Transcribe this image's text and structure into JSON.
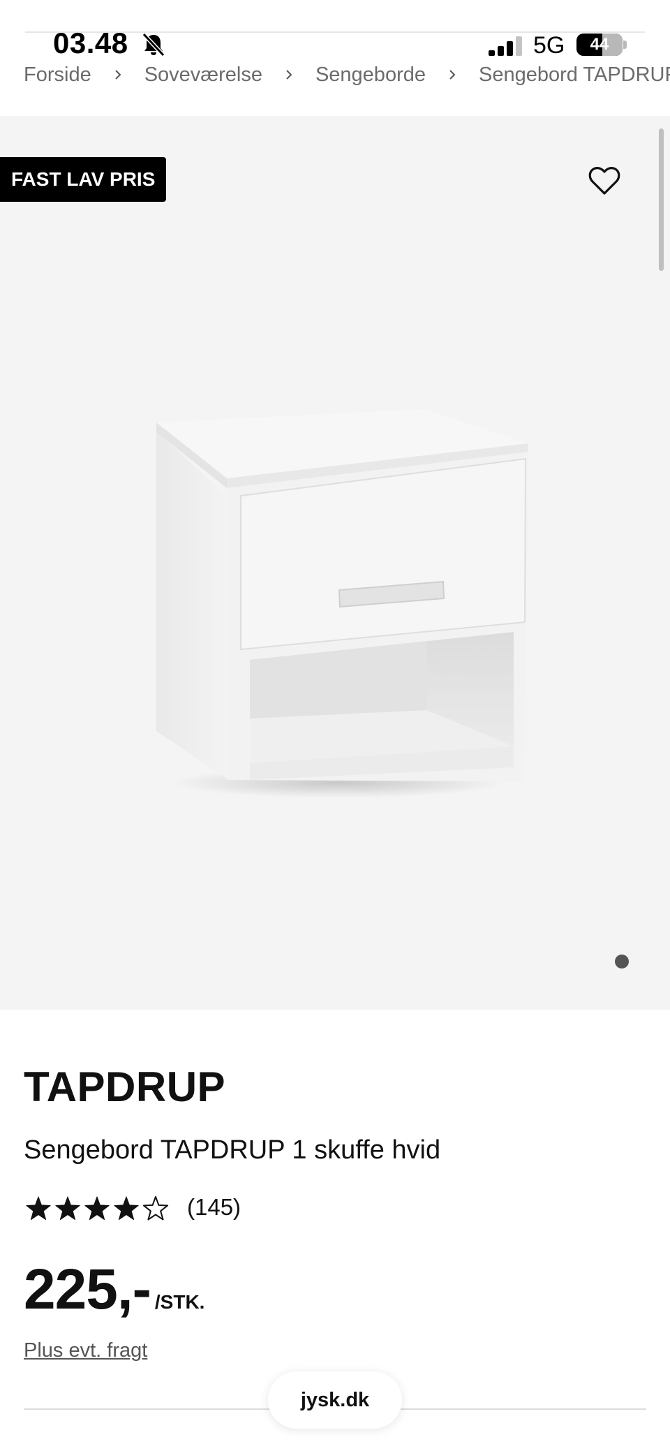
{
  "status_bar": {
    "time": "03.48",
    "mute_icon": "bell-slash-icon",
    "signal_icon": "cellular-signal-icon",
    "network": "5G",
    "battery": "44",
    "battery_level": 0.44
  },
  "breadcrumb": {
    "items": [
      "Forside",
      "Soveværelse",
      "Sengeborde",
      "Sengebord TAPDRUP"
    ],
    "separator_icon": "chevron-right-icon"
  },
  "gallery": {
    "badge": "FAST LAV PRIS",
    "wishlist_icon": "heart-outline-icon",
    "image_subject": "white bedside table with one drawer and open shelf",
    "current_slide": 1,
    "total_slides": 1
  },
  "product": {
    "brand": "TAPDRUP",
    "title": "Sengebord TAPDRUP 1 skuffe hvid",
    "rating": 4,
    "rating_max": 5,
    "review_count": "(145)",
    "price": "225,-",
    "unit": "/STK.",
    "shipping_note": "Plus evt. fragt"
  },
  "browser": {
    "url": "jysk.dk"
  },
  "colors": {
    "accent": "#000000",
    "gallery_bg": "#f4f4f4",
    "breadcrumb_text": "#6b6b6b"
  }
}
